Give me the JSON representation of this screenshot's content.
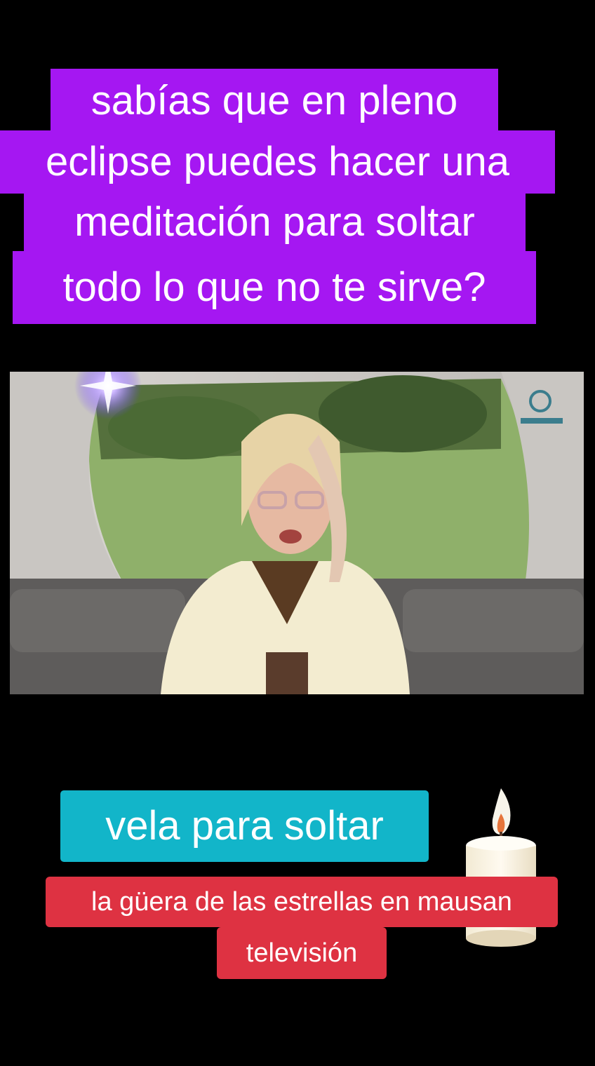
{
  "headline": {
    "lines": [
      "sabías que en pleno",
      "eclipse puedes hacer una",
      "meditación para soltar",
      "todo lo que no te sirve?"
    ]
  },
  "sticker": {
    "label": "vela para soltar"
  },
  "subtitle": {
    "lines": [
      "la güera de las estrellas en mausan",
      "televisión"
    ]
  },
  "colors": {
    "headline_bg": "#a517f2",
    "sticker_bg": "#12b5c9",
    "subtitle_bg": "#de3242",
    "page_bg": "#000000"
  },
  "icons": [
    "sparkle-logo-icon",
    "tv-channel-logo-icon",
    "candle-icon"
  ]
}
